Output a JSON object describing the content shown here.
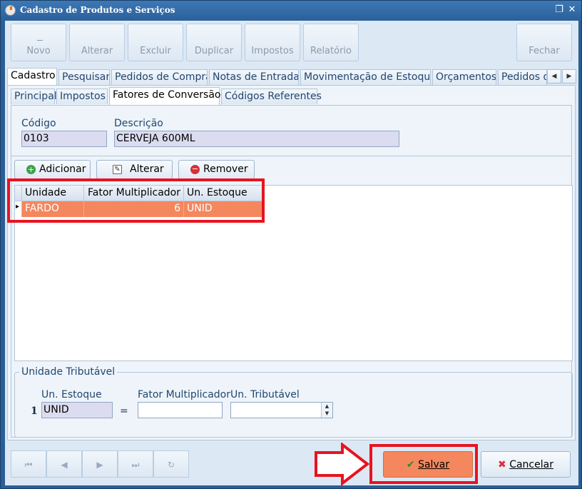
{
  "window": {
    "title": "Cadastro de Produtos e Serviços",
    "restore_glyph": "❐",
    "close_glyph": "✕"
  },
  "toolbar": {
    "buttons": [
      {
        "label": "Novo",
        "enabled": false
      },
      {
        "label": "Alterar",
        "enabled": false
      },
      {
        "label": "Excluir",
        "enabled": false
      },
      {
        "label": "Duplicar",
        "enabled": false
      },
      {
        "label": "Impostos",
        "enabled": false
      },
      {
        "label": "Relatório",
        "enabled": false
      }
    ],
    "close_label": "Fechar"
  },
  "tabs": [
    {
      "label": "Cadastro",
      "active": true
    },
    {
      "label": "Pesquisar"
    },
    {
      "label": "Pedidos de Compra"
    },
    {
      "label": "Notas de Entrada"
    },
    {
      "label": "Movimentação de Estoque"
    },
    {
      "label": "Orçamentos"
    },
    {
      "label": "Pedidos de"
    }
  ],
  "tab_scroll": {
    "left": "◀",
    "right": "▶"
  },
  "subtabs": [
    {
      "label": "Principal"
    },
    {
      "label": "Impostos"
    },
    {
      "label": "Fatores de Conversão",
      "active": true
    },
    {
      "label": "Códigos Referentes"
    }
  ],
  "product": {
    "code_label": "Código",
    "code_value": "0103",
    "description_label": "Descrição",
    "description_value": "CERVEJA 600ML"
  },
  "actions": {
    "add_label": "Adicionar",
    "edit_label": "Alterar",
    "remove_label": "Remover"
  },
  "grid": {
    "columns": [
      "Unidade",
      "Fator Multiplicador",
      "Un. Estoque"
    ],
    "rows": [
      {
        "unidade": "FARDO",
        "fator": "6",
        "estoque": "UNID"
      }
    ],
    "row_indicator": "▸"
  },
  "tributavel": {
    "group_title": "Unidade Tributável",
    "row_number": "1",
    "un_estoque_label": "Un. Estoque",
    "un_estoque_value": "UNID",
    "equals": "=",
    "fator_label": "Fator Multiplicador",
    "fator_value": "",
    "un_tributavel_label": "Un. Tributável",
    "un_tributavel_value": ""
  },
  "navigation": {
    "first": "⏮",
    "prev": "◀",
    "next": "▶",
    "last": "⏭",
    "refresh": "↻"
  },
  "footer": {
    "save_label": "Salvar",
    "cancel_label": "Cancelar"
  },
  "annotations": {
    "highlight_color": "#e8131f",
    "accent_row_color": "#f4875d"
  }
}
